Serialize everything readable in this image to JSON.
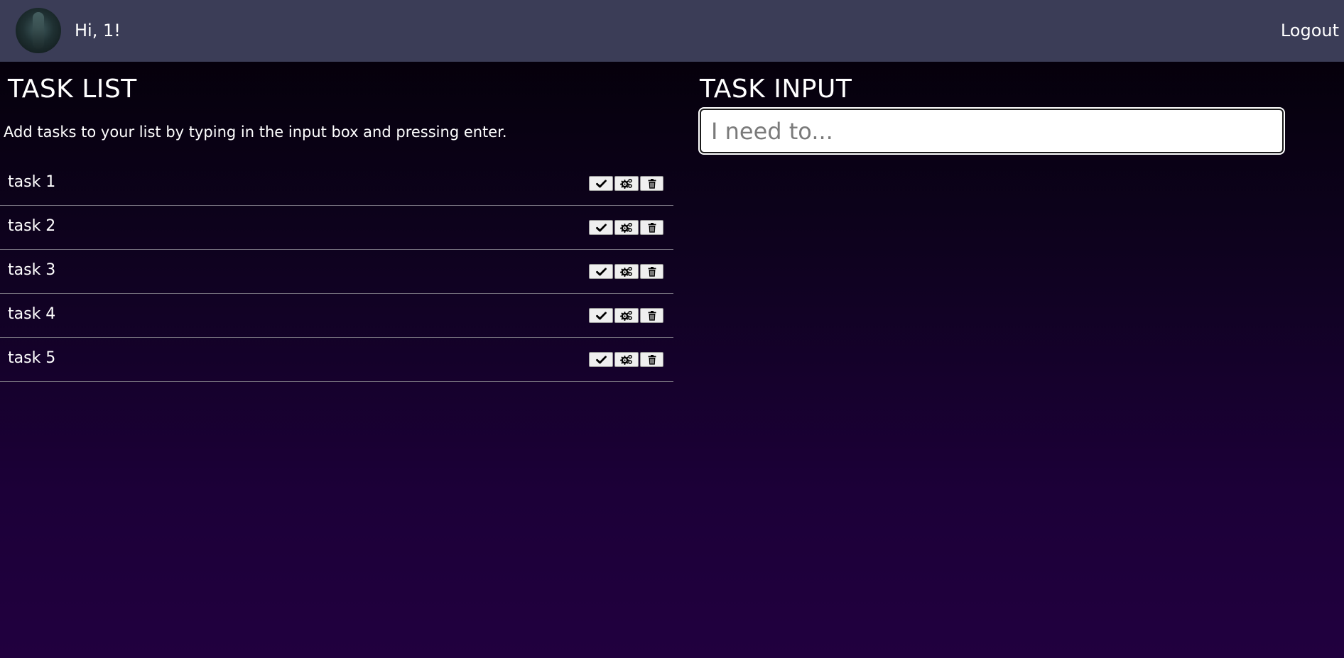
{
  "header": {
    "greeting": "Hi, 1!",
    "logout_label": "Logout",
    "background_color": "#3b3d57"
  },
  "task_list": {
    "title": "TASK LIST",
    "instructions": "Add tasks to your list by typing in the input box and pressing enter.",
    "tasks": [
      {
        "label": "task 1"
      },
      {
        "label": "task 2"
      },
      {
        "label": "task 3"
      },
      {
        "label": "task 4"
      },
      {
        "label": "task 5"
      }
    ],
    "action_icons": [
      "check-icon",
      "gears-icon",
      "trash-icon"
    ]
  },
  "task_input": {
    "title": "TASK INPUT",
    "placeholder": "I need to...",
    "value": ""
  }
}
